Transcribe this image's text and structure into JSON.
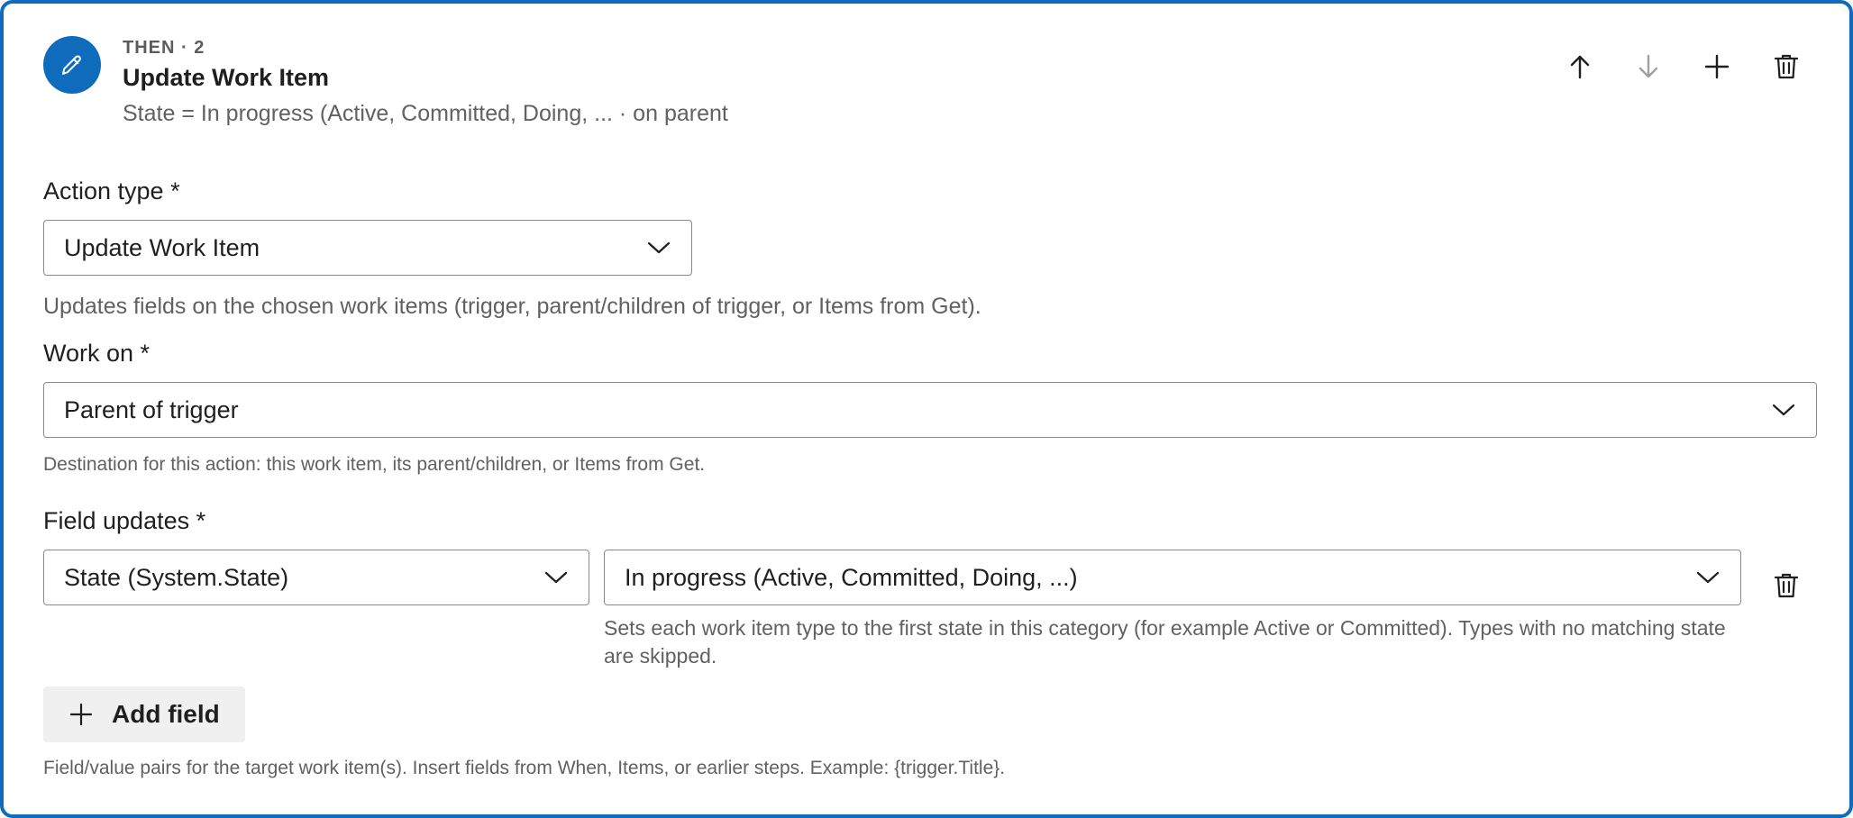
{
  "step": {
    "eyebrow": "THEN · 2",
    "title": "Update Work Item",
    "summary": "State = In progress (Active, Committed, Doing, ... · on parent"
  },
  "toolbar": {
    "move_up": "arrow-up-icon",
    "move_down": "arrow-down-icon",
    "add": "plus-icon",
    "delete": "trash-icon"
  },
  "action_type": {
    "label": "Action type *",
    "value": "Update Work Item",
    "helper": "Updates fields on the chosen work items (trigger, parent/children of trigger, or Items from Get)."
  },
  "work_on": {
    "label": "Work on *",
    "value": "Parent of trigger",
    "helper": "Destination for this action: this work item, its parent/children, or Items from Get."
  },
  "field_updates": {
    "label": "Field updates *",
    "rows": [
      {
        "field": "State (System.State)",
        "value": "In progress (Active, Committed, Doing, ...)",
        "value_helper": "Sets each work item type to the first state in this category (for example Active or Committed). Types with no matching state are skipped."
      }
    ],
    "add_label": "Add field",
    "helper": "Field/value pairs for the target work item(s). Insert fields from When, Items, or earlier steps. Example: {trigger.Title}."
  },
  "colors": {
    "accent": "#0f6cbd",
    "text": "#1f1f1f",
    "muted": "#616161",
    "disabled_icon": "#a0a0a0"
  }
}
